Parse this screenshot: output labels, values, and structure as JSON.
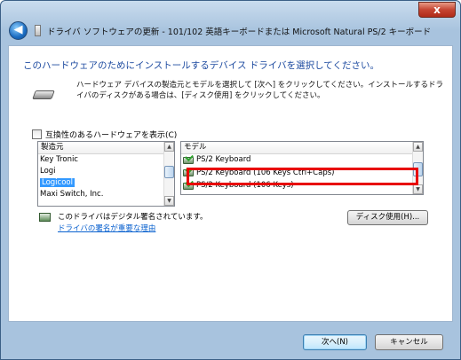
{
  "window": {
    "title": "ドライバ ソフトウェアの更新 - 101/102 英語キーボードまたは Microsoft Natural PS/2 キーボード",
    "close_label": "x",
    "back_label": "◀"
  },
  "content": {
    "heading": "このハードウェアのためにインストールするデバイス ドライバを選択してください。",
    "description": "ハードウェア デバイスの製造元とモデルを選択して [次へ] をクリックしてください。インストールするドライバのディスクがある場合は、[ディスク使用] をクリックしてください。",
    "compat_label": "互換性のあるハードウェアを表示(C)",
    "manufacturer": {
      "header": "製造元",
      "items": [
        "Key Tronic",
        "Logi",
        "Logicool",
        "Maxi Switch, Inc."
      ],
      "selected": "Logicool"
    },
    "model": {
      "header": "モデル",
      "items": [
        "PS/2 Keyboard",
        "PS/2 Keyboard (106 Keys Ctrl+Caps)",
        "PS/2 Keyboard (106 Keys)"
      ]
    },
    "signature_text": "このドライバはデジタル署名されています。",
    "signature_link": "ドライバの署名が重要な理由",
    "disk_button": "ディスク使用(H)..."
  },
  "footer": {
    "next_button": "次へ(N)",
    "cancel_button": "キャンセル"
  },
  "colors": {
    "heading": "#1e4ba0",
    "link": "#0b62cf",
    "highlight": "#e80000",
    "selection": "#3399ff"
  }
}
